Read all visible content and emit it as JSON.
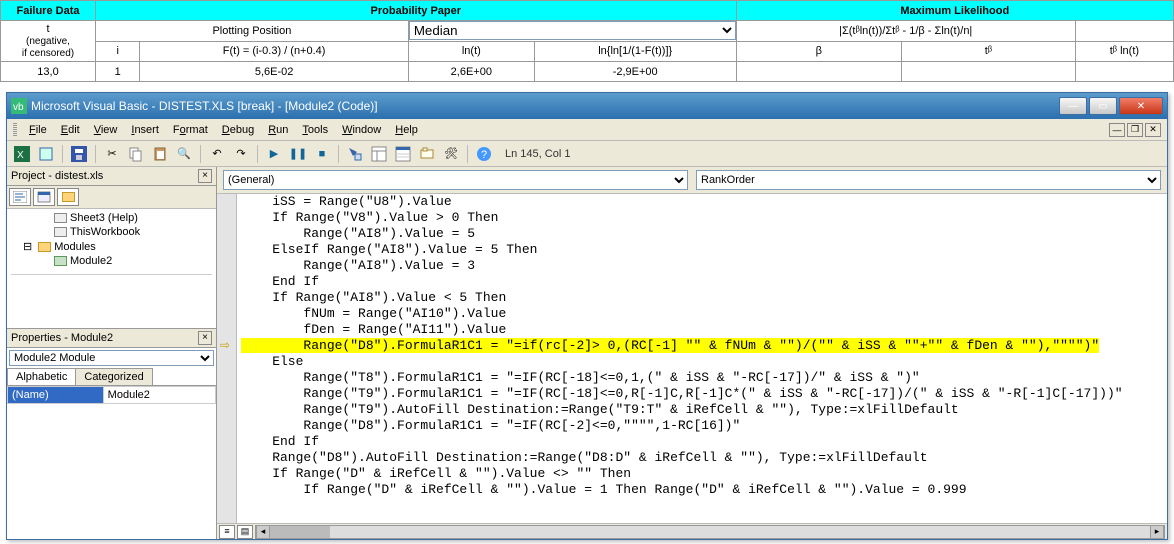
{
  "sheet": {
    "headers1": {
      "failure": "Failure Data",
      "prob": "Probability Paper",
      "max": "Maximum Likelihood"
    },
    "row2": {
      "t": "t",
      "plotpos": "Plotting Position",
      "median": "Median",
      "ml_formula": "|Σ(tᵝln(t))/Σtᵝ - 1/β - Σln(t)/n|"
    },
    "row3": {
      "neg": "(negative,\nif censored)",
      "i": "i",
      "ft": "F(t) = (i-0.3) / (n+0.4)",
      "lnt": "ln(t)",
      "lnln": "ln{ln[1/(1-F(t))]}",
      "beta": "β",
      "tb": "tᵝ",
      "tblnt": "tᵝ ln(t)"
    },
    "row4": {
      "v1": "13,0",
      "v2": "1",
      "v3": "5,6E-02",
      "v4": "2,6E+00",
      "v5": "-2,9E+00"
    }
  },
  "vbe": {
    "title": "Microsoft Visual Basic - DISTEST.XLS [break] - [Module2 (Code)]",
    "menu": [
      "File",
      "Edit",
      "View",
      "Insert",
      "Format",
      "Debug",
      "Run",
      "Tools",
      "Window",
      "Help"
    ],
    "status": "Ln 145, Col 1",
    "project": {
      "title": "Project - distest.xls",
      "items": {
        "sheet3": "Sheet3 (Help)",
        "thiswb": "ThisWorkbook",
        "modules": "Modules",
        "module2": "Module2"
      }
    },
    "props": {
      "title": "Properties - Module2",
      "combo": "Module2 Module",
      "tabs": {
        "alpha": "Alphabetic",
        "cat": "Categorized"
      },
      "row": {
        "k": "(Name)",
        "v": "Module2"
      }
    },
    "code": {
      "left_combo": "(General)",
      "right_combo": "RankOrder",
      "lines": [
        "    iSS = Range(\"U8\").Value",
        "    If Range(\"V8\").Value > 0 Then",
        "        Range(\"AI8\").Value = 5",
        "    ElseIf Range(\"AI8\").Value = 5 Then",
        "        Range(\"AI8\").Value = 3",
        "    End If",
        "    If Range(\"AI8\").Value < 5 Then",
        "        fNUm = Range(\"AI10\").Value",
        "        fDen = Range(\"AI11\").Value",
        "        Range(\"D8\").FormulaR1C1 = \"=if(rc[-2]> 0,(RC[-1] \"\" & fNUm & \"\")/(\"\" & iSS & \"\"+\"\" & fDen & \"\"),\"\"\"\")\"",
        "    Else",
        "        Range(\"T8\").FormulaR1C1 = \"=IF(RC[-18]<=0,1,(\" & iSS & \"-RC[-17])/\" & iSS & \")\"",
        "        Range(\"T9\").FormulaR1C1 = \"=IF(RC[-18]<=0,R[-1]C,R[-1]C*(\" & iSS & \"-RC[-17])/(\" & iSS & \"-R[-1]C[-17]))\"",
        "        Range(\"T9\").AutoFill Destination:=Range(\"T9:T\" & iRefCell & \"\"), Type:=xlFillDefault",
        "        Range(\"D8\").FormulaR1C1 = \"=IF(RC[-2]<=0,\"\"\"\",1-RC[16])\"",
        "    End If",
        "    Range(\"D8\").AutoFill Destination:=Range(\"D8:D\" & iRefCell & \"\"), Type:=xlFillDefault",
        "    If Range(\"D\" & iRefCell & \"\").Value <> \"\" Then",
        "        If Range(\"D\" & iRefCell & \"\").Value = 1 Then Range(\"D\" & iRefCell & \"\").Value = 0.999"
      ],
      "highlight_index": 9,
      "arrow_index": 9
    },
    "icons": {
      "excel": "excel-icon",
      "save": "save-icon",
      "cut": "cut-icon",
      "copy": "copy-icon",
      "paste": "paste-icon",
      "find": "find-icon",
      "undo": "undo-icon",
      "redo": "redo-icon",
      "run": "run-icon",
      "break": "break-icon",
      "reset": "reset-icon",
      "design": "design-icon",
      "projexp": "project-explorer-icon",
      "propwin": "properties-window-icon",
      "objbrw": "object-browser-icon",
      "toolbox": "toolbox-icon",
      "help": "help-icon"
    }
  }
}
